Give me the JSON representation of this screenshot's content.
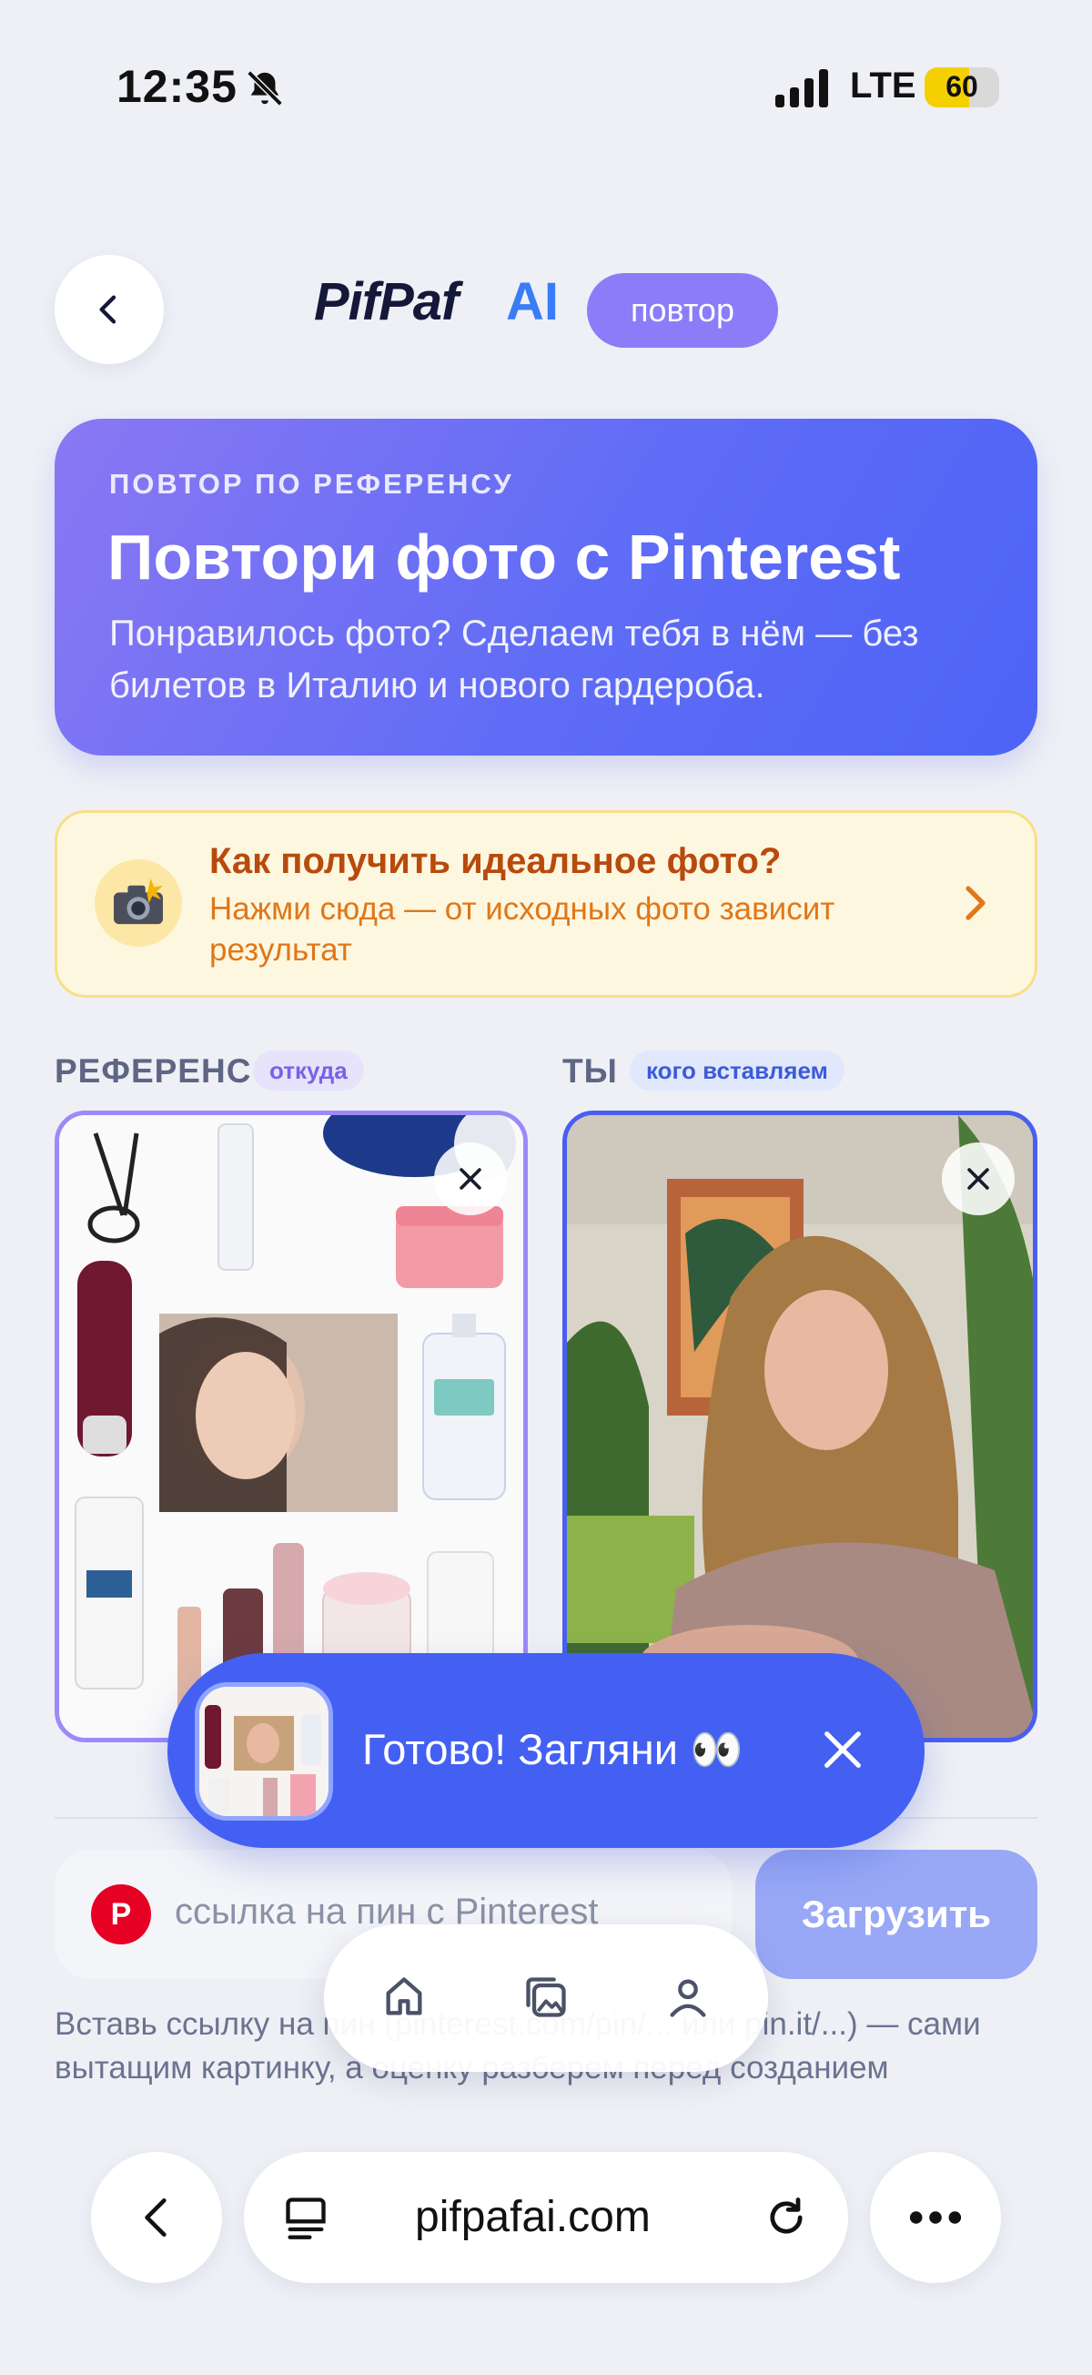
{
  "status_bar": {
    "time": "12:35",
    "network": "LTE",
    "battery": "60",
    "battery_level": 0.6
  },
  "header": {
    "logo": "PifPaf",
    "logo_ai": "AI",
    "mode_pill": "повтор"
  },
  "hero": {
    "kicker": "ПОВТОР ПО РЕФЕРЕНСУ",
    "title": "Повтори фото с Pinterest",
    "subtitle": "Понравилось фото? Сделаем тебя в нём — без билетов в Италию и нового гардероба."
  },
  "tip": {
    "title": "Как получить идеальное фото?",
    "subtitle": "Нажми сюда — от исходных фото зависит результат"
  },
  "reference": {
    "label": "РЕФЕРЕНС",
    "tag": "откуда"
  },
  "you": {
    "label": "ТЫ",
    "tag": "кого вставляем"
  },
  "toast": {
    "text": "Готово! Загляни 👀"
  },
  "pin_input": {
    "logo": "P",
    "placeholder": "ссылка на пин с Pinterest"
  },
  "upload_button": "Загрузить",
  "hint": "Вставь ссылку на пин (pinterest.com/pin/... или pin.it/...) — сами вытащим картинку, а оценку разберем перед созданием",
  "browser": {
    "url": "pifpafai.com"
  },
  "colors": {
    "accent": "#4460f3",
    "hero_start": "#8a78f3",
    "hero_end": "#4d63f7",
    "tip_bg": "#fef7df",
    "tip_title": "#b84a0d",
    "pinterest": "#e60023"
  }
}
